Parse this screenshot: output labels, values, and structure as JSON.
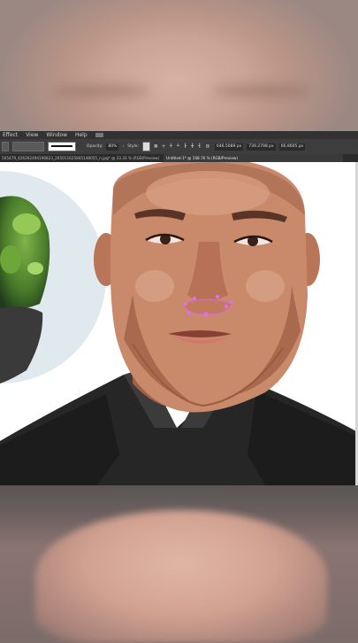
{
  "menubar": {
    "items": [
      "Effect",
      "View",
      "Window",
      "Help"
    ]
  },
  "control_bar": {
    "stroke_style": "Basic",
    "opacity_label": "Opacity:",
    "opacity_value": "80%",
    "style_label": "Style:",
    "x_value": "646.5089 px",
    "y_value": "739.2798 px",
    "w_value": "66.8605 px"
  },
  "tabs": [
    {
      "label": "505479_426262494190823_205011625845148055_n.jpg* @ 33.33 % (RGB/Preview)"
    },
    {
      "label": "Untitled-1* @ 168.76 % (RGB/Preview)"
    }
  ],
  "colors": {
    "skin": "#c98a6c",
    "shirt": "#2a2a2a",
    "anchor": "#e070e0",
    "ui_dark": "#323232"
  }
}
